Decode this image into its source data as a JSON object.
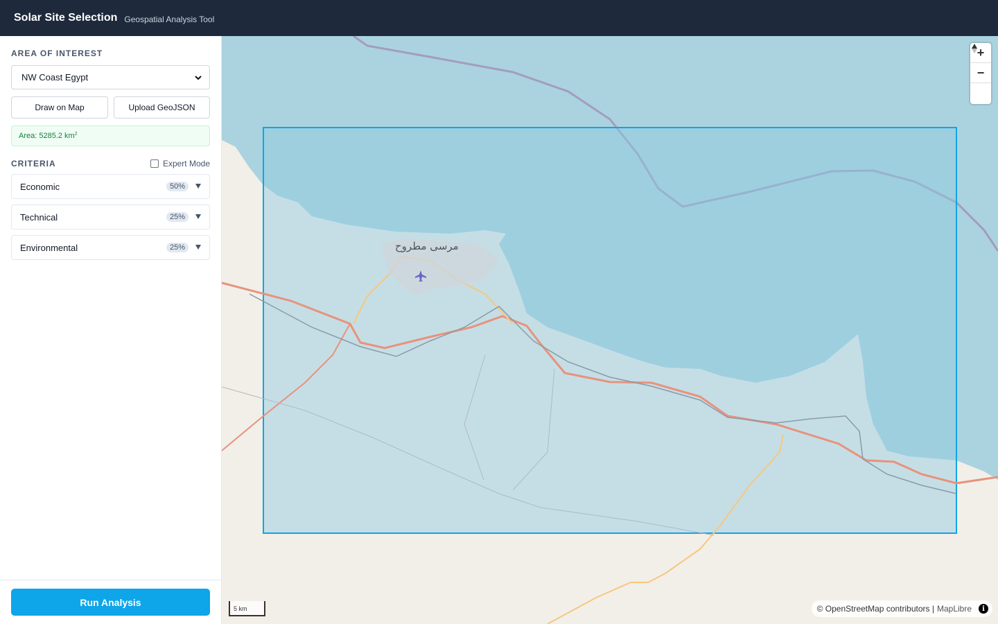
{
  "header": {
    "title": "Solar Site Selection",
    "subtitle": "Geospatial Analysis Tool"
  },
  "sidebar": {
    "aoi_label": "AREA OF INTEREST",
    "aoi_selected": "NW Coast Egypt",
    "draw_button": "Draw on Map",
    "upload_button": "Upload GeoJSON",
    "area_text": "Area: 5285.2 km",
    "area_unit_sup": "2",
    "criteria_label": "CRITERIA",
    "expert_mode_label": "Expert Mode",
    "expert_mode_checked": false,
    "criteria": [
      {
        "name": "Economic",
        "weight": "50%"
      },
      {
        "name": "Technical",
        "weight": "25%"
      },
      {
        "name": "Environmental",
        "weight": "25%"
      }
    ],
    "run_button": "Run Analysis"
  },
  "map": {
    "city_label": "مرسى مطروح",
    "zoom_in": "+",
    "zoom_out": "−",
    "scale_label": "5 km",
    "attribution": "© OpenStreetMap contributors |",
    "attribution_lib": "MapLibre",
    "info_glyph": "i",
    "colors": {
      "sea": "#aad3df",
      "land": "#f2efe9",
      "selection_fill": "#8ec9e0",
      "selection_stroke": "#0ea5e9",
      "road_primary": "#e8927c",
      "road_secondary": "#f6c77f",
      "boundary": "#9e7aa6"
    },
    "icons": [
      "airport-icon",
      "north-arrow-icon",
      "info-icon"
    ]
  }
}
